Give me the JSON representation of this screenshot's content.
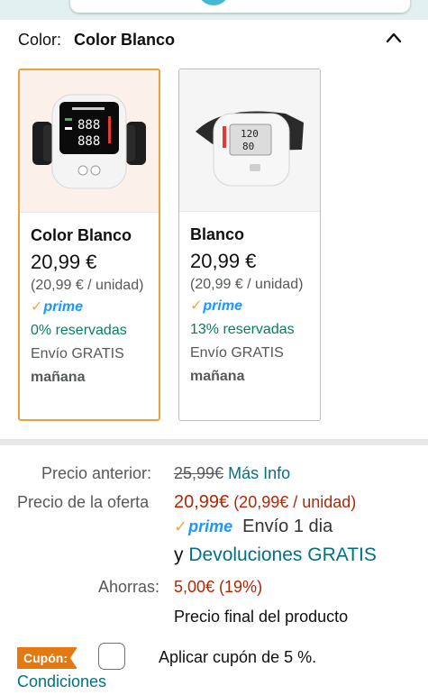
{
  "selector": {
    "label": "Color:",
    "value": "Color Blanco",
    "collapse_icon": "chevron-up-icon"
  },
  "variants": [
    {
      "name": "Color Blanco",
      "price": "20,99 €",
      "unit_price": "(20,99 € / unidad)",
      "prime": "prime",
      "reserved": "0% reservadas",
      "shipping": "Envío GRATIS",
      "shipping_day": "mañana",
      "selected": true
    },
    {
      "name": "Blanco",
      "price": "20,99 €",
      "unit_price": "(20,99 € / unidad)",
      "prime": "prime",
      "reserved": "13% reservadas",
      "shipping": "Envío GRATIS",
      "shipping_day": "mañana",
      "selected": false
    }
  ],
  "pricing": {
    "previous_label": "Precio anterior:",
    "previous_price": "25,99€",
    "more_info": "Más Info",
    "deal_label": "Precio de la oferta",
    "deal_price": "20,99€",
    "deal_unit": "(20,99€ / unidad)",
    "prime": "prime",
    "delivery": "Envío 1 dia",
    "returns_prefix": "y",
    "returns_link": "Devoluciones GRATIS",
    "savings_label": "Ahorras:",
    "savings_value": "5,00€ (19%)",
    "final_note": "Precio final del producto"
  },
  "coupon": {
    "tag": "Cupón:",
    "text": "Aplicar cupón de 5 %.",
    "conditions": "Condiciones"
  },
  "colors": {
    "selected_border": "#e8a33c",
    "link": "#007185",
    "deal": "#b12704",
    "reserved": "#067d62",
    "prime_blue": "#1a98ff",
    "coupon_orange": "#e47911"
  }
}
